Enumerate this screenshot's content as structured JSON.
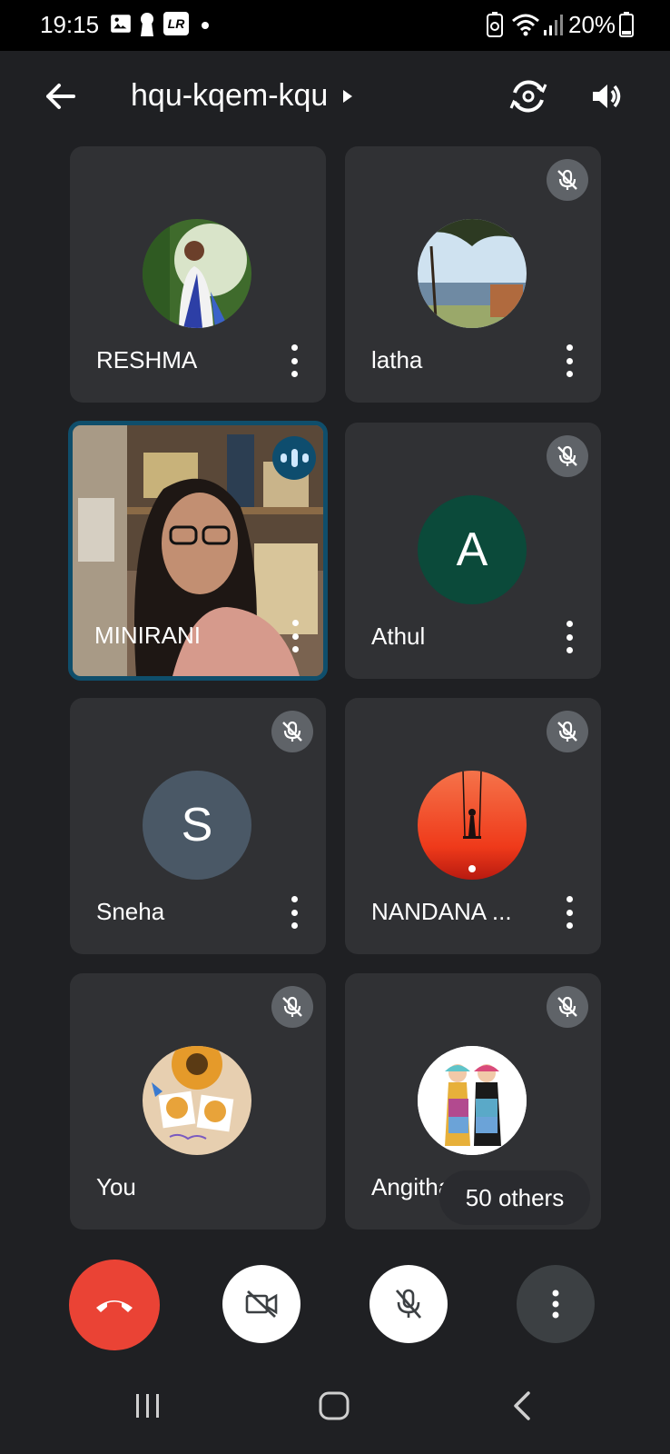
{
  "status_bar": {
    "time": "19:15",
    "battery_percent": "20%",
    "icons": [
      "gallery-icon",
      "keyhole-icon",
      "lr-app-icon",
      "dot-icon",
      "recycle-battery-icon",
      "wifi-icon",
      "signal-icon",
      "battery-icon"
    ],
    "lr_label": "LR"
  },
  "top_bar": {
    "back_icon": "arrow-left-icon",
    "meeting_code": "hqu-kqem-kqu",
    "expand_icon": "caret-right-icon",
    "switch_camera_icon": "switch-camera-icon",
    "speaker_icon": "speaker-icon"
  },
  "participants": [
    {
      "name": "RESHMA",
      "muted": false,
      "avatar_type": "photo"
    },
    {
      "name": "latha",
      "muted": true,
      "avatar_type": "photo"
    },
    {
      "name": "MINIRANI",
      "muted": false,
      "speaking": true,
      "avatar_type": "video"
    },
    {
      "name": "Athul",
      "muted": true,
      "avatar_type": "initial",
      "initial": "A",
      "color": "#0b4a3a"
    },
    {
      "name": "Sneha",
      "muted": true,
      "avatar_type": "initial",
      "initial": "S",
      "color": "#4a5866"
    },
    {
      "name": "NANDANA ...",
      "muted": true,
      "avatar_type": "photo"
    },
    {
      "name": "You",
      "muted": true,
      "avatar_type": "photo"
    },
    {
      "name": "Angitha",
      "muted": true,
      "avatar_type": "photo"
    }
  ],
  "others_label": "50 others",
  "controls": [
    {
      "name": "end-call",
      "icon": "phone-hangup-icon",
      "color": "#ea4335"
    },
    {
      "name": "camera-off",
      "icon": "video-off-icon",
      "color": "#ffffff"
    },
    {
      "name": "mic-off",
      "icon": "mic-off-icon",
      "color": "#ffffff"
    },
    {
      "name": "more-options",
      "icon": "more-vert-icon",
      "color": "#3c4043"
    }
  ],
  "nav_bar": [
    "recent-apps-icon",
    "home-icon",
    "back-icon"
  ],
  "colors": {
    "background": "#1f2023",
    "tile": "#303134",
    "active_border": "#0f4e6b",
    "end_call": "#ea4335"
  }
}
